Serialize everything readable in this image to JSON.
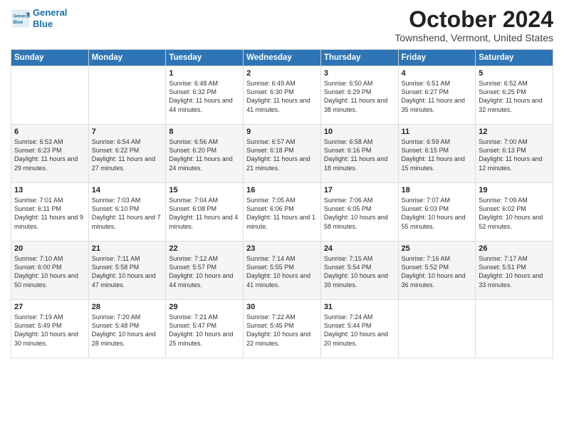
{
  "logo": {
    "line1": "General",
    "line2": "Blue"
  },
  "title": "October 2024",
  "subtitle": "Townshend, Vermont, United States",
  "days_of_week": [
    "Sunday",
    "Monday",
    "Tuesday",
    "Wednesday",
    "Thursday",
    "Friday",
    "Saturday"
  ],
  "weeks": [
    [
      {
        "day": "",
        "info": ""
      },
      {
        "day": "",
        "info": ""
      },
      {
        "day": "1",
        "info": "Sunrise: 6:48 AM\nSunset: 6:32 PM\nDaylight: 11 hours and 44 minutes."
      },
      {
        "day": "2",
        "info": "Sunrise: 6:49 AM\nSunset: 6:30 PM\nDaylight: 11 hours and 41 minutes."
      },
      {
        "day": "3",
        "info": "Sunrise: 6:50 AM\nSunset: 6:29 PM\nDaylight: 11 hours and 38 minutes."
      },
      {
        "day": "4",
        "info": "Sunrise: 6:51 AM\nSunset: 6:27 PM\nDaylight: 11 hours and 35 minutes."
      },
      {
        "day": "5",
        "info": "Sunrise: 6:52 AM\nSunset: 6:25 PM\nDaylight: 11 hours and 32 minutes."
      }
    ],
    [
      {
        "day": "6",
        "info": "Sunrise: 6:53 AM\nSunset: 6:23 PM\nDaylight: 11 hours and 29 minutes."
      },
      {
        "day": "7",
        "info": "Sunrise: 6:54 AM\nSunset: 6:22 PM\nDaylight: 11 hours and 27 minutes."
      },
      {
        "day": "8",
        "info": "Sunrise: 6:56 AM\nSunset: 6:20 PM\nDaylight: 11 hours and 24 minutes."
      },
      {
        "day": "9",
        "info": "Sunrise: 6:57 AM\nSunset: 6:18 PM\nDaylight: 11 hours and 21 minutes."
      },
      {
        "day": "10",
        "info": "Sunrise: 6:58 AM\nSunset: 6:16 PM\nDaylight: 11 hours and 18 minutes."
      },
      {
        "day": "11",
        "info": "Sunrise: 6:59 AM\nSunset: 6:15 PM\nDaylight: 11 hours and 15 minutes."
      },
      {
        "day": "12",
        "info": "Sunrise: 7:00 AM\nSunset: 6:13 PM\nDaylight: 11 hours and 12 minutes."
      }
    ],
    [
      {
        "day": "13",
        "info": "Sunrise: 7:01 AM\nSunset: 6:11 PM\nDaylight: 11 hours and 9 minutes."
      },
      {
        "day": "14",
        "info": "Sunrise: 7:03 AM\nSunset: 6:10 PM\nDaylight: 11 hours and 7 minutes."
      },
      {
        "day": "15",
        "info": "Sunrise: 7:04 AM\nSunset: 6:08 PM\nDaylight: 11 hours and 4 minutes."
      },
      {
        "day": "16",
        "info": "Sunrise: 7:05 AM\nSunset: 6:06 PM\nDaylight: 11 hours and 1 minute."
      },
      {
        "day": "17",
        "info": "Sunrise: 7:06 AM\nSunset: 6:05 PM\nDaylight: 10 hours and 58 minutes."
      },
      {
        "day": "18",
        "info": "Sunrise: 7:07 AM\nSunset: 6:03 PM\nDaylight: 10 hours and 55 minutes."
      },
      {
        "day": "19",
        "info": "Sunrise: 7:09 AM\nSunset: 6:02 PM\nDaylight: 10 hours and 52 minutes."
      }
    ],
    [
      {
        "day": "20",
        "info": "Sunrise: 7:10 AM\nSunset: 6:00 PM\nDaylight: 10 hours and 50 minutes."
      },
      {
        "day": "21",
        "info": "Sunrise: 7:11 AM\nSunset: 5:58 PM\nDaylight: 10 hours and 47 minutes."
      },
      {
        "day": "22",
        "info": "Sunrise: 7:12 AM\nSunset: 5:57 PM\nDaylight: 10 hours and 44 minutes."
      },
      {
        "day": "23",
        "info": "Sunrise: 7:14 AM\nSunset: 5:55 PM\nDaylight: 10 hours and 41 minutes."
      },
      {
        "day": "24",
        "info": "Sunrise: 7:15 AM\nSunset: 5:54 PM\nDaylight: 10 hours and 39 minutes."
      },
      {
        "day": "25",
        "info": "Sunrise: 7:16 AM\nSunset: 5:52 PM\nDaylight: 10 hours and 36 minutes."
      },
      {
        "day": "26",
        "info": "Sunrise: 7:17 AM\nSunset: 5:51 PM\nDaylight: 10 hours and 33 minutes."
      }
    ],
    [
      {
        "day": "27",
        "info": "Sunrise: 7:19 AM\nSunset: 5:49 PM\nDaylight: 10 hours and 30 minutes."
      },
      {
        "day": "28",
        "info": "Sunrise: 7:20 AM\nSunset: 5:48 PM\nDaylight: 10 hours and 28 minutes."
      },
      {
        "day": "29",
        "info": "Sunrise: 7:21 AM\nSunset: 5:47 PM\nDaylight: 10 hours and 25 minutes."
      },
      {
        "day": "30",
        "info": "Sunrise: 7:22 AM\nSunset: 5:45 PM\nDaylight: 10 hours and 22 minutes."
      },
      {
        "day": "31",
        "info": "Sunrise: 7:24 AM\nSunset: 5:44 PM\nDaylight: 10 hours and 20 minutes."
      },
      {
        "day": "",
        "info": ""
      },
      {
        "day": "",
        "info": ""
      }
    ]
  ]
}
